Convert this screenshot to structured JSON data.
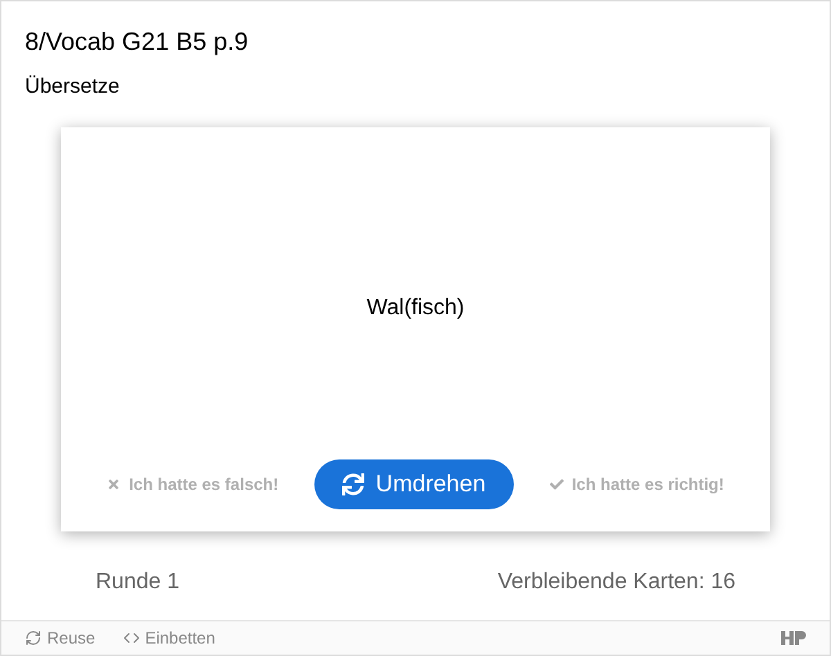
{
  "title": "8/Vocab G21 B5 p.9",
  "task": "Übersetze",
  "card": {
    "word": "Wal(fisch)"
  },
  "actions": [
    {
      "kind": "wrong",
      "label": "Ich hatte es falsch!",
      "disabled": true
    },
    {
      "kind": "flip",
      "label": "Umdrehen",
      "disabled": false
    },
    {
      "kind": "right",
      "label": "Ich hatte es richtig!",
      "disabled": true
    }
  ],
  "round": "Runde 1",
  "remaining": "Verbleibende Karten: 16",
  "footer": [
    {
      "kind": "reuse",
      "label": "Reuse"
    },
    {
      "kind": "embed",
      "label": "Einbetten"
    }
  ]
}
